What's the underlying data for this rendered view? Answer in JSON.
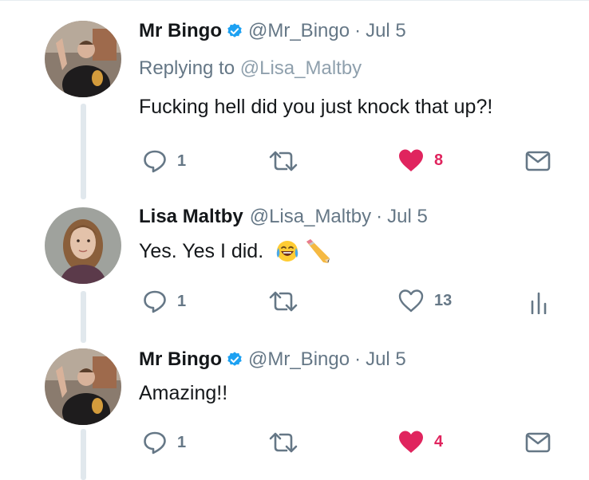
{
  "tweets": [
    {
      "name": "Mr Bingo",
      "verified": true,
      "handle": "@Mr_Bingo",
      "separator": "·",
      "date": "Jul 5",
      "replying_prefix": "Replying to",
      "replying_to": "@Lisa_Maltby",
      "text": "Fucking hell did you just knock that up?!",
      "replies": "1",
      "likes": "8",
      "liked": true,
      "last_action": "mail-icon"
    },
    {
      "name": "Lisa Maltby",
      "verified": false,
      "handle": "@Lisa_Maltby",
      "separator": "·",
      "date": "Jul 5",
      "text": "Yes. Yes I did.",
      "text_emojis": [
        "tears-of-joy-emoji",
        "pencil-emoji"
      ],
      "replies": "1",
      "likes": "13",
      "liked": false,
      "last_action": "analytics-icon"
    },
    {
      "name": "Mr Bingo",
      "verified": true,
      "handle": "@Mr_Bingo",
      "separator": "·",
      "date": "Jul 5",
      "text": "Amazing!!",
      "replies": "1",
      "likes": "4",
      "liked": true,
      "last_action": "mail-icon"
    }
  ],
  "colors": {
    "text": "#14171a",
    "muted": "#657786",
    "verified": "#1da1f2",
    "like": "#e0245e",
    "thread_line": "#e1e8ed"
  }
}
